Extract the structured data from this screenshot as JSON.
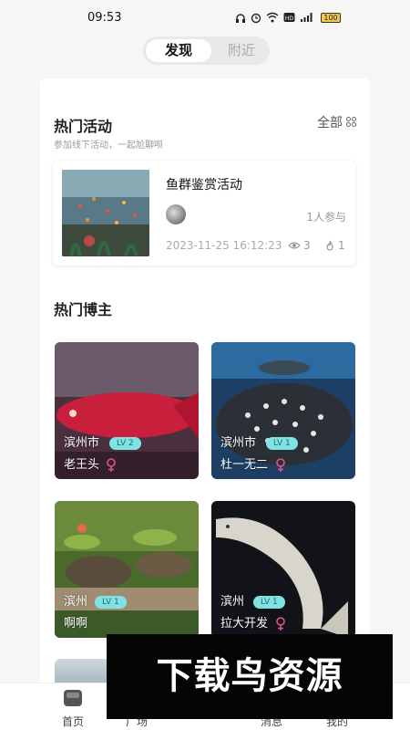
{
  "status": {
    "time": "09:53",
    "battery": "100",
    "icons": [
      "headphones-icon",
      "alarm-icon",
      "wifi-icon",
      "hd-icon",
      "signal-icon"
    ]
  },
  "tabs_top": {
    "active": "发现",
    "inactive": "附近"
  },
  "hot_activities": {
    "title": "热门活动",
    "subtitle": "参加线下活动，一起尬聊呗",
    "all_label": "全部",
    "card": {
      "title": "鱼群鉴赏活动",
      "participants": "1人参与",
      "datetime": "2023-11-25 16:12:23",
      "views": "3",
      "likes": "1"
    }
  },
  "hot_bloggers": {
    "title": "热门博主",
    "items": [
      {
        "city": "滨州市",
        "level": "LV 2",
        "name": "老王头"
      },
      {
        "city": "滨州市",
        "level": "LV 1",
        "name": "杜一无二"
      },
      {
        "city": "滨州",
        "level": "LV 1",
        "name": "啊啊"
      },
      {
        "city": "滨州",
        "level": "LV 1",
        "name": "拉大开发"
      }
    ]
  },
  "bottom_tabs": [
    {
      "label": "首页"
    },
    {
      "label": "广场"
    },
    {
      "label": "消息"
    },
    {
      "label": "我的"
    }
  ],
  "watermark": "下载鸟资源",
  "colors": {
    "accent_teal": "#7fe3e3",
    "female_pink": "#e8508a"
  }
}
